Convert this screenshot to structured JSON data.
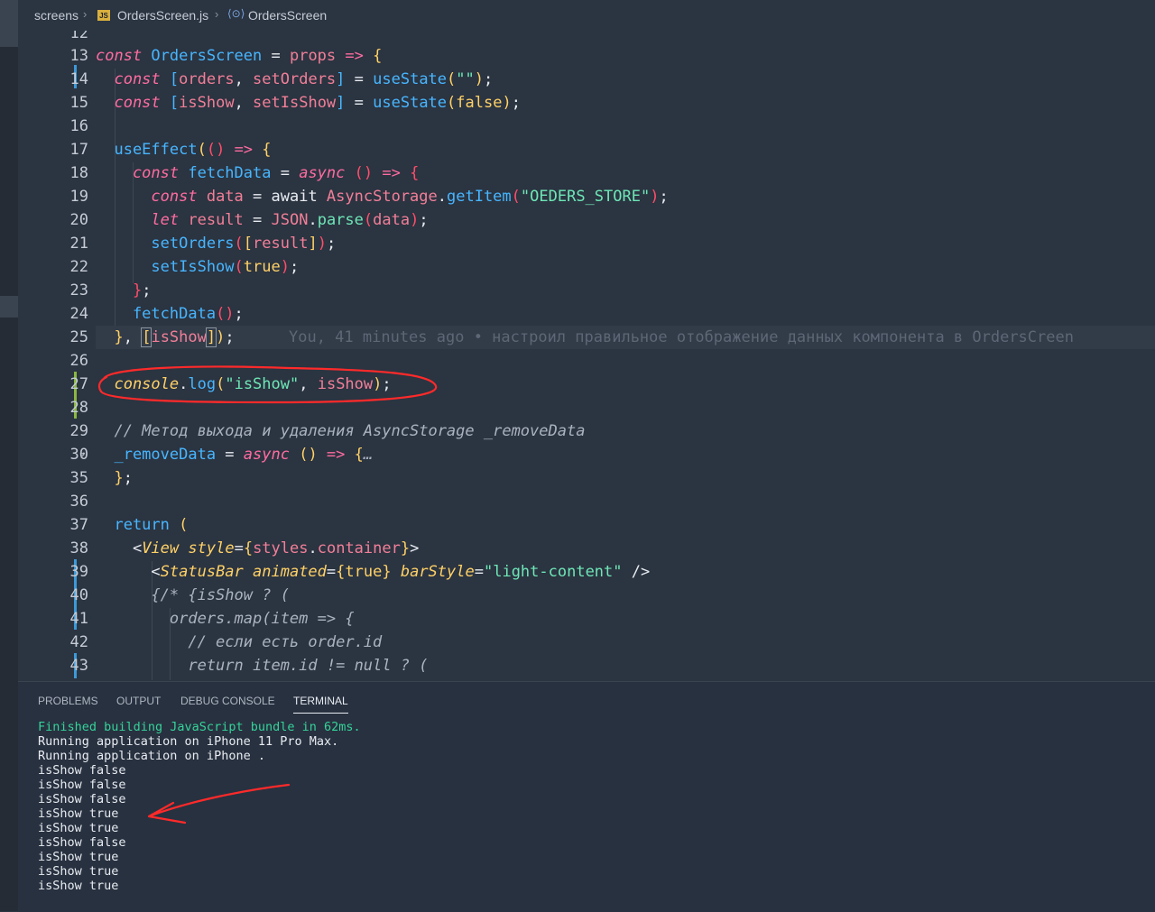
{
  "breadcrumb": {
    "folder": "screens",
    "file": "OrdersScreen.js",
    "file_icon": "JS",
    "symbol": "OrdersScreen",
    "symbol_icon": "symbol-icon"
  },
  "editor": {
    "lines": [
      {
        "n": "12"
      },
      {
        "n": "13"
      },
      {
        "n": "14"
      },
      {
        "n": "15"
      },
      {
        "n": "16"
      },
      {
        "n": "17"
      },
      {
        "n": "18"
      },
      {
        "n": "19"
      },
      {
        "n": "20"
      },
      {
        "n": "21"
      },
      {
        "n": "22"
      },
      {
        "n": "23"
      },
      {
        "n": "24"
      },
      {
        "n": "25"
      },
      {
        "n": "26"
      },
      {
        "n": "27"
      },
      {
        "n": "28"
      },
      {
        "n": "29"
      },
      {
        "n": "30"
      },
      {
        "n": "35"
      },
      {
        "n": "36"
      },
      {
        "n": "37"
      },
      {
        "n": "38"
      },
      {
        "n": "39"
      },
      {
        "n": "40"
      },
      {
        "n": "41"
      },
      {
        "n": "42"
      },
      {
        "n": "43"
      }
    ],
    "code": {
      "l13": [
        "const",
        " OrdersScreen",
        " = ",
        "props",
        " => ",
        "{"
      ],
      "l14": [
        "  const",
        " [",
        "orders",
        ", ",
        "setOrders",
        "]",
        " = ",
        "useState",
        "(",
        "\"\"",
        ")",
        ";"
      ],
      "l15": [
        "  const",
        " [",
        "isShow",
        ", ",
        "setIsShow",
        "]",
        " = ",
        "useState",
        "(",
        "false",
        ")",
        ";"
      ],
      "l17": [
        "  useEffect",
        "(",
        "()",
        " => ",
        "{"
      ],
      "l18": [
        "    const",
        " fetchData",
        " = ",
        "async",
        " ()",
        " => ",
        "{"
      ],
      "l19": [
        "      const",
        " data",
        " = ",
        "await",
        " AsyncStorage",
        ".",
        "getItem",
        "(",
        "\"OEDERS_STORE\"",
        ")",
        ";"
      ],
      "l20": [
        "      let",
        " result",
        " = ",
        "JSON",
        ".",
        "parse",
        "(",
        "data",
        ")",
        ";"
      ],
      "l21": [
        "      setOrders",
        "(",
        "[",
        "result",
        "]",
        ")",
        ";"
      ],
      "l22": [
        "      setIsShow",
        "(",
        "true",
        ")",
        ";"
      ],
      "l23": [
        "    }",
        ";"
      ],
      "l24": [
        "    fetchData",
        "()",
        ";"
      ],
      "l25": [
        "  }",
        ", ",
        "[",
        "isShow",
        "]",
        ")",
        ";"
      ],
      "l27": [
        "  console",
        ".",
        "log",
        "(",
        "\"isShow\"",
        ", ",
        "isShow",
        ")",
        ";"
      ],
      "l29": [
        "  // Метод выхода и удаления AsyncStorage _removeData"
      ],
      "l30": [
        "  _removeData",
        " = ",
        "async",
        " ()",
        " => ",
        "{",
        "…"
      ],
      "l35": [
        "  }",
        ";"
      ],
      "l37": [
        "  return",
        " ("
      ],
      "l38": [
        "    <",
        "View",
        " style",
        "=",
        "{",
        "styles",
        ".",
        "container",
        "}",
        ">"
      ],
      "l39": [
        "      <",
        "StatusBar",
        " animated",
        "=",
        "{",
        "true",
        "}",
        " barStyle",
        "=",
        "\"light-content\"",
        " />"
      ],
      "l40": [
        "      {/* {isShow ? ("
      ],
      "l41": [
        "        orders.map(item => {"
      ],
      "l42": [
        "          // если есть order.id"
      ],
      "l43": [
        "          return item.id != null ? ("
      ]
    },
    "blame": "You, 41 minutes ago • настроил правильное отображение данных компонента в OrdersCreen"
  },
  "panel": {
    "tabs": [
      "PROBLEMS",
      "OUTPUT",
      "DEBUG CONSOLE",
      "TERMINAL"
    ],
    "active_tab": "TERMINAL",
    "terminal_lines": [
      "Finished building JavaScript bundle in 62ms.",
      "Running application on iPhone 11 Pro Max.",
      "Running application on iPhone .",
      "isShow false",
      "isShow false",
      "isShow false",
      "isShow true",
      "isShow true",
      "isShow false",
      "isShow true",
      "isShow true",
      "isShow true"
    ]
  },
  "colors": {
    "background": "#2b3441",
    "keyword": "#ff6ca0",
    "function": "#47b6ff",
    "string": "#6ee7b7",
    "bracket": "#ffd166",
    "annotation": "#ff2a2a",
    "terminal_green": "#34d399"
  }
}
